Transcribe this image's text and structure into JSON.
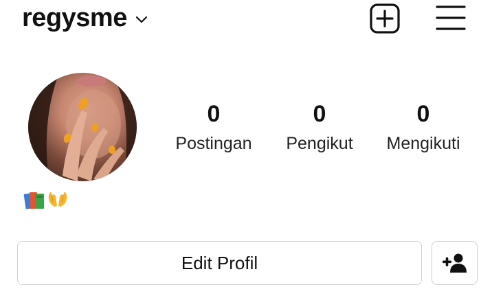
{
  "header": {
    "username": "regysme",
    "icons": {
      "dropdown": "chevron-down-icon",
      "new_post": "plus-square-icon",
      "menu": "hamburger-menu-icon"
    }
  },
  "profile": {
    "stats": [
      {
        "value": "0",
        "label": "Postingan"
      },
      {
        "value": "0",
        "label": "Pengikut"
      },
      {
        "value": "0",
        "label": "Mengikuti"
      }
    ],
    "bio_emoji": [
      "books-emoji",
      "open-hands-emoji"
    ]
  },
  "actions": {
    "edit_label": "Edit Profil",
    "add_person_icon": "add-person-icon"
  },
  "colors": {
    "text": "#111111",
    "border": "#cfcfcf",
    "accent_orange": "#f0a020"
  }
}
